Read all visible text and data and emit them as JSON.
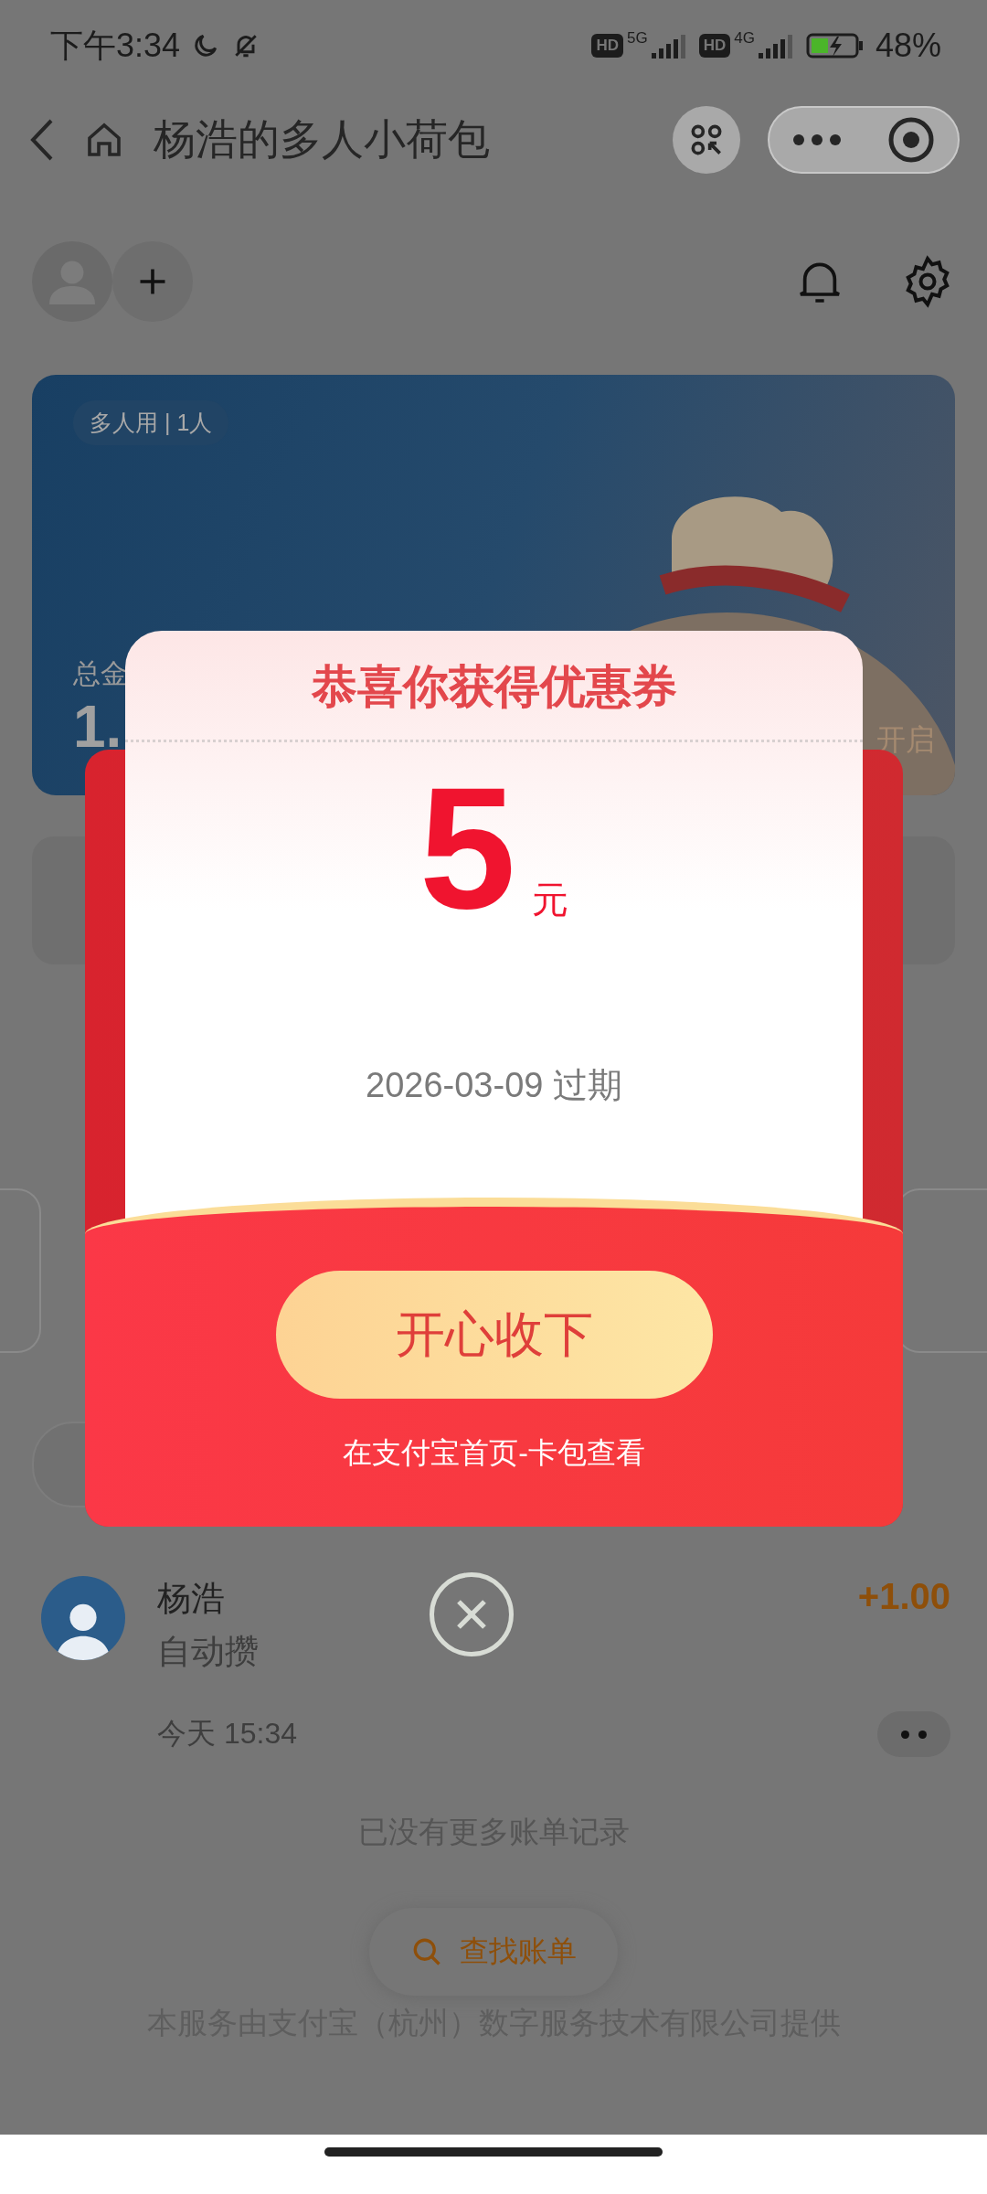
{
  "status_bar": {
    "time": "下午3:34",
    "sims": [
      {
        "badge": "HD",
        "network": "5G"
      },
      {
        "badge": "HD",
        "network": "4G"
      }
    ],
    "battery": "48%"
  },
  "nav": {
    "title": "杨浩的多人小荷包"
  },
  "card": {
    "tag": "多人用 | 1人",
    "total_label": "总金",
    "total_value": "1.",
    "right_text": "开启"
  },
  "modal": {
    "title": "恭喜你获得优惠券",
    "amount": "5",
    "unit": "元",
    "expiry": "2026-03-09 过期",
    "button": "开心收下",
    "hint": "在支付宝首页-卡包查看"
  },
  "bills": [
    {
      "name": "杨浩",
      "type": "自动攒",
      "amount": "+1.00",
      "time": "今天 15:34"
    }
  ],
  "end_note": "已没有更多账单记录",
  "search_button": "查找账单",
  "footer": "本服务由支付宝（杭州）数字服务技术有限公司提供"
}
